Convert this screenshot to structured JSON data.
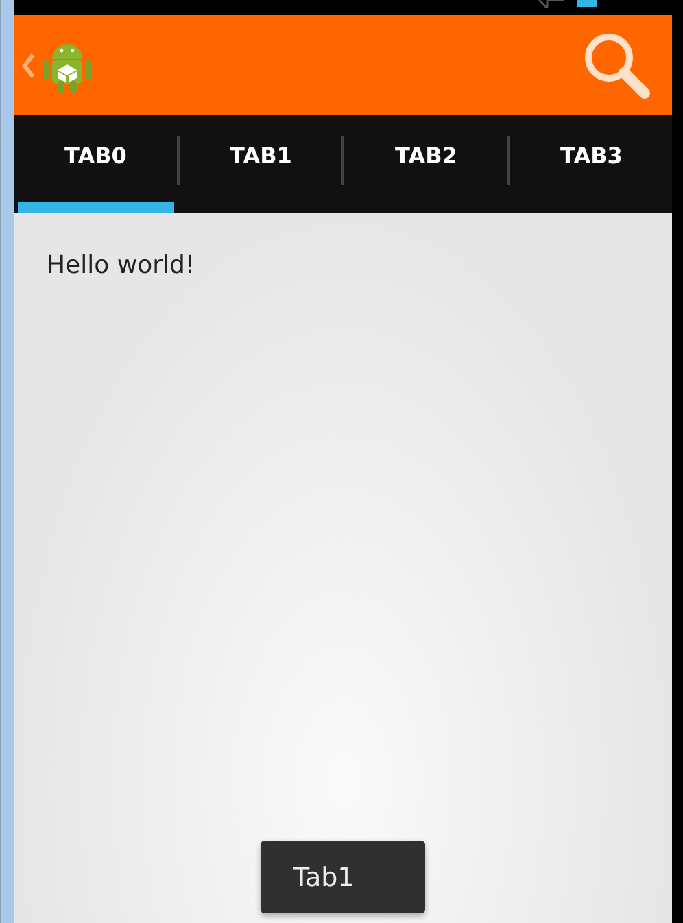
{
  "tabs": [
    {
      "label": "TAB0",
      "selected": true
    },
    {
      "label": "TAB1",
      "selected": false
    },
    {
      "label": "TAB2",
      "selected": false
    },
    {
      "label": "TAB3",
      "selected": false
    }
  ],
  "content": {
    "text": "Hello world!"
  },
  "toast": {
    "text": "Tab1"
  }
}
